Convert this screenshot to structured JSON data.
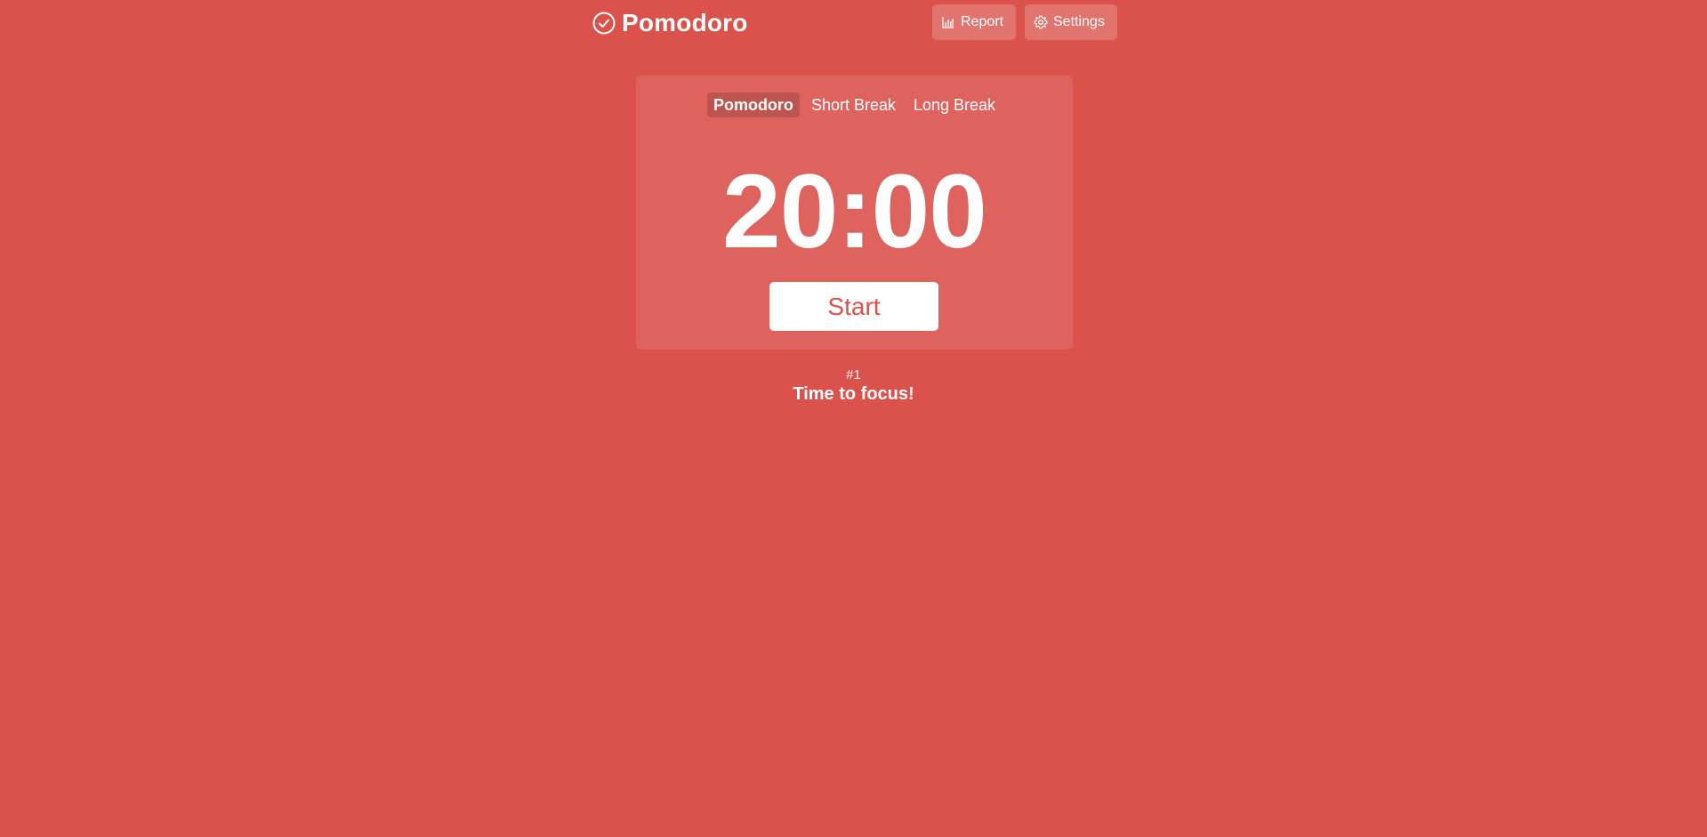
{
  "header": {
    "app_title": "Pomodoro",
    "logo_icon": "check-circle-icon",
    "report_label": "Report",
    "report_icon": "bar-chart-icon",
    "settings_label": "Settings",
    "settings_icon": "gear-icon"
  },
  "timer": {
    "tabs": [
      {
        "label": "Pomodoro",
        "active": true
      },
      {
        "label": "Short Break",
        "active": false
      },
      {
        "label": "Long Break",
        "active": false
      }
    ],
    "time": "20:00",
    "start_label": "Start"
  },
  "status": {
    "session_count": "#1",
    "message": "Time to focus!"
  },
  "colors": {
    "background": "#db524d",
    "text": "#ffffff"
  }
}
